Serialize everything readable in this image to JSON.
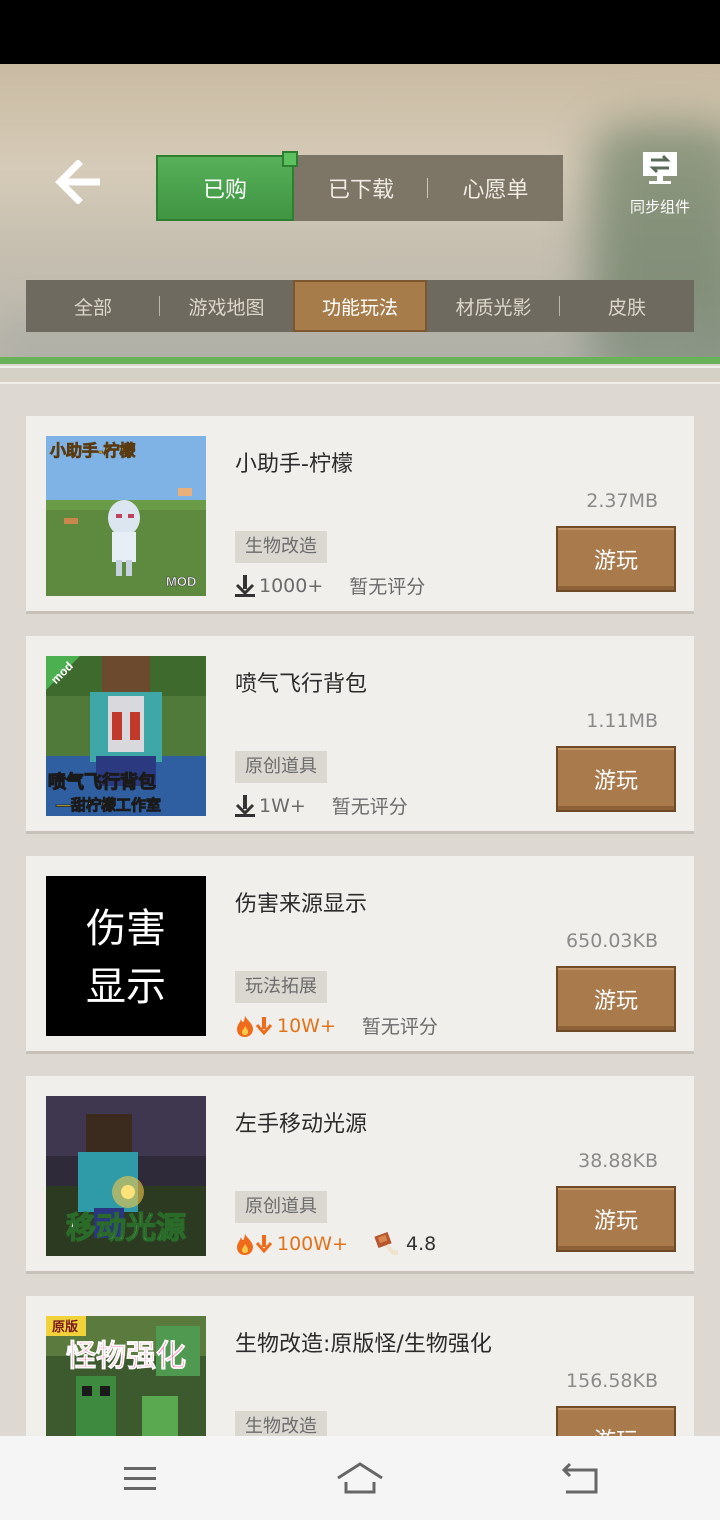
{
  "header": {
    "tabs": [
      "已购",
      "已下载",
      "心愿单"
    ],
    "active_tab": "已购",
    "sync_label": "同步组件"
  },
  "categories": {
    "items": [
      "全部",
      "游戏地图",
      "功能玩法",
      "材质光影",
      "皮肤"
    ],
    "active": "功能玩法"
  },
  "items": [
    {
      "title": "小助手-柠檬",
      "size": "2.37MB",
      "tag": "生物改造",
      "downloads": "1000+",
      "hot": false,
      "rating": "暂无评分",
      "button": "游玩",
      "thumb_caption": "小助手-柠檬",
      "thumb_badge": "MOD"
    },
    {
      "title": "喷气飞行背包",
      "size": "1.11MB",
      "tag": "原创道具",
      "downloads": "1W+",
      "hot": false,
      "rating": "暂无评分",
      "button": "游玩",
      "thumb_caption": "喷气飞行背包",
      "thumb_caption2": "—甜柠檬工作室",
      "thumb_badge": "mod"
    },
    {
      "title": "伤害来源显示",
      "size": "650.03KB",
      "tag": "玩法拓展",
      "downloads": "10W+",
      "hot": true,
      "rating": "暂无评分",
      "button": "游玩",
      "thumb_caption": "伤害",
      "thumb_caption2": "显示"
    },
    {
      "title": "左手移动光源",
      "size": "38.88KB",
      "tag": "原创道具",
      "downloads": "100W+",
      "hot": true,
      "rating": "4.8",
      "button": "游玩",
      "thumb_caption": "移动光源"
    },
    {
      "title": "生物改造:原版怪/生物强化",
      "size": "156.58KB",
      "tag": "生物改造",
      "button": "游玩",
      "thumb_caption": "怪物强化",
      "thumb_badge": "原版"
    }
  ],
  "colors": {
    "accent_green": "#3f9542",
    "play_brown": "#a87a4c",
    "hot_orange": "#e2731a"
  }
}
